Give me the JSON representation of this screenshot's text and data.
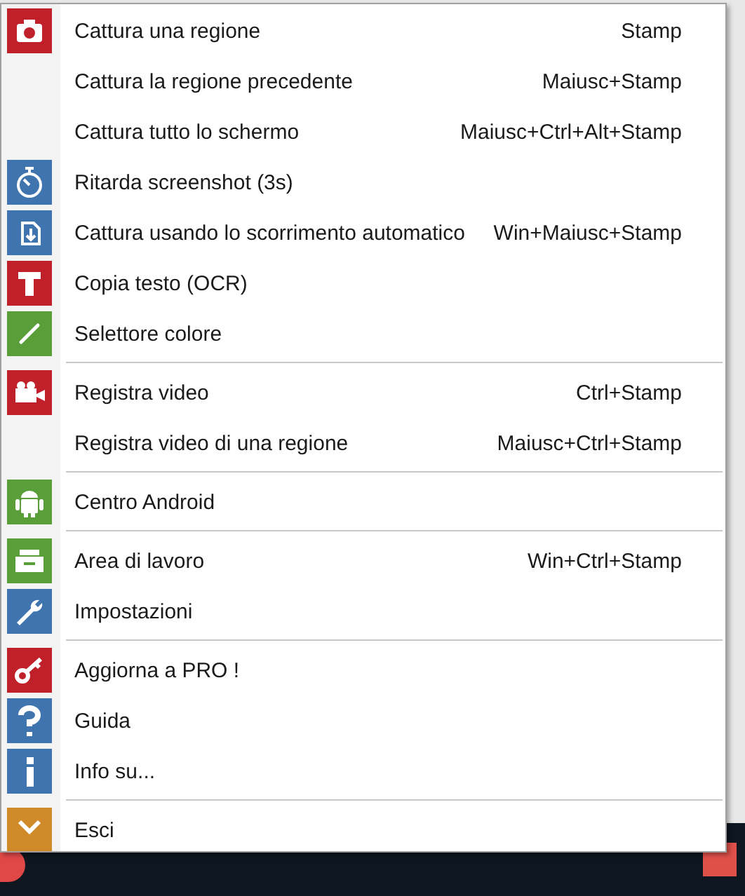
{
  "menu": {
    "sections": [
      {
        "items": [
          {
            "label": "Cattura una regione",
            "shortcut": "Stamp",
            "kind": "camera",
            "color": "#c0202a"
          },
          {
            "label": "Cattura la regione precedente",
            "shortcut": "Maiusc+Stamp"
          },
          {
            "label": "Cattura tutto lo schermo",
            "shortcut": "Maiusc+Ctrl+Alt+Stamp"
          },
          {
            "label": "Ritarda screenshot (3s)",
            "kind": "stopwatch",
            "color": "#3f74ae"
          },
          {
            "label": "Cattura usando lo scorrimento automatico",
            "shortcut": "Win+Maiusc+Stamp",
            "kind": "scroll",
            "color": "#3f74ae"
          },
          {
            "label": "Copia testo (OCR)",
            "kind": "text",
            "color": "#c0202a"
          },
          {
            "label": "Selettore colore",
            "kind": "dropper",
            "color": "#5a9e3a"
          }
        ]
      },
      {
        "items": [
          {
            "label": "Registra video",
            "shortcut": "Ctrl+Stamp",
            "kind": "video",
            "color": "#c0202a"
          },
          {
            "label": "Registra video di una regione",
            "shortcut": "Maiusc+Ctrl+Stamp"
          }
        ]
      },
      {
        "items": [
          {
            "label": "Centro Android",
            "kind": "android",
            "color": "#5a9e3a"
          }
        ]
      },
      {
        "items": [
          {
            "label": "Area di lavoro",
            "shortcut": "Win+Ctrl+Stamp",
            "kind": "tray",
            "color": "#5a9e3a"
          },
          {
            "label": "Impostazioni",
            "kind": "wrench",
            "color": "#3f74ae"
          }
        ]
      },
      {
        "items": [
          {
            "label": "Aggiorna a PRO !",
            "kind": "key",
            "color": "#c0202a"
          },
          {
            "label": "Guida",
            "kind": "question",
            "color": "#3f74ae"
          },
          {
            "label": "Info su...",
            "kind": "info",
            "color": "#3f74ae"
          }
        ]
      },
      {
        "items": [
          {
            "label": "Esci",
            "kind": "exit",
            "color": "#d08a2a"
          }
        ]
      }
    ]
  }
}
